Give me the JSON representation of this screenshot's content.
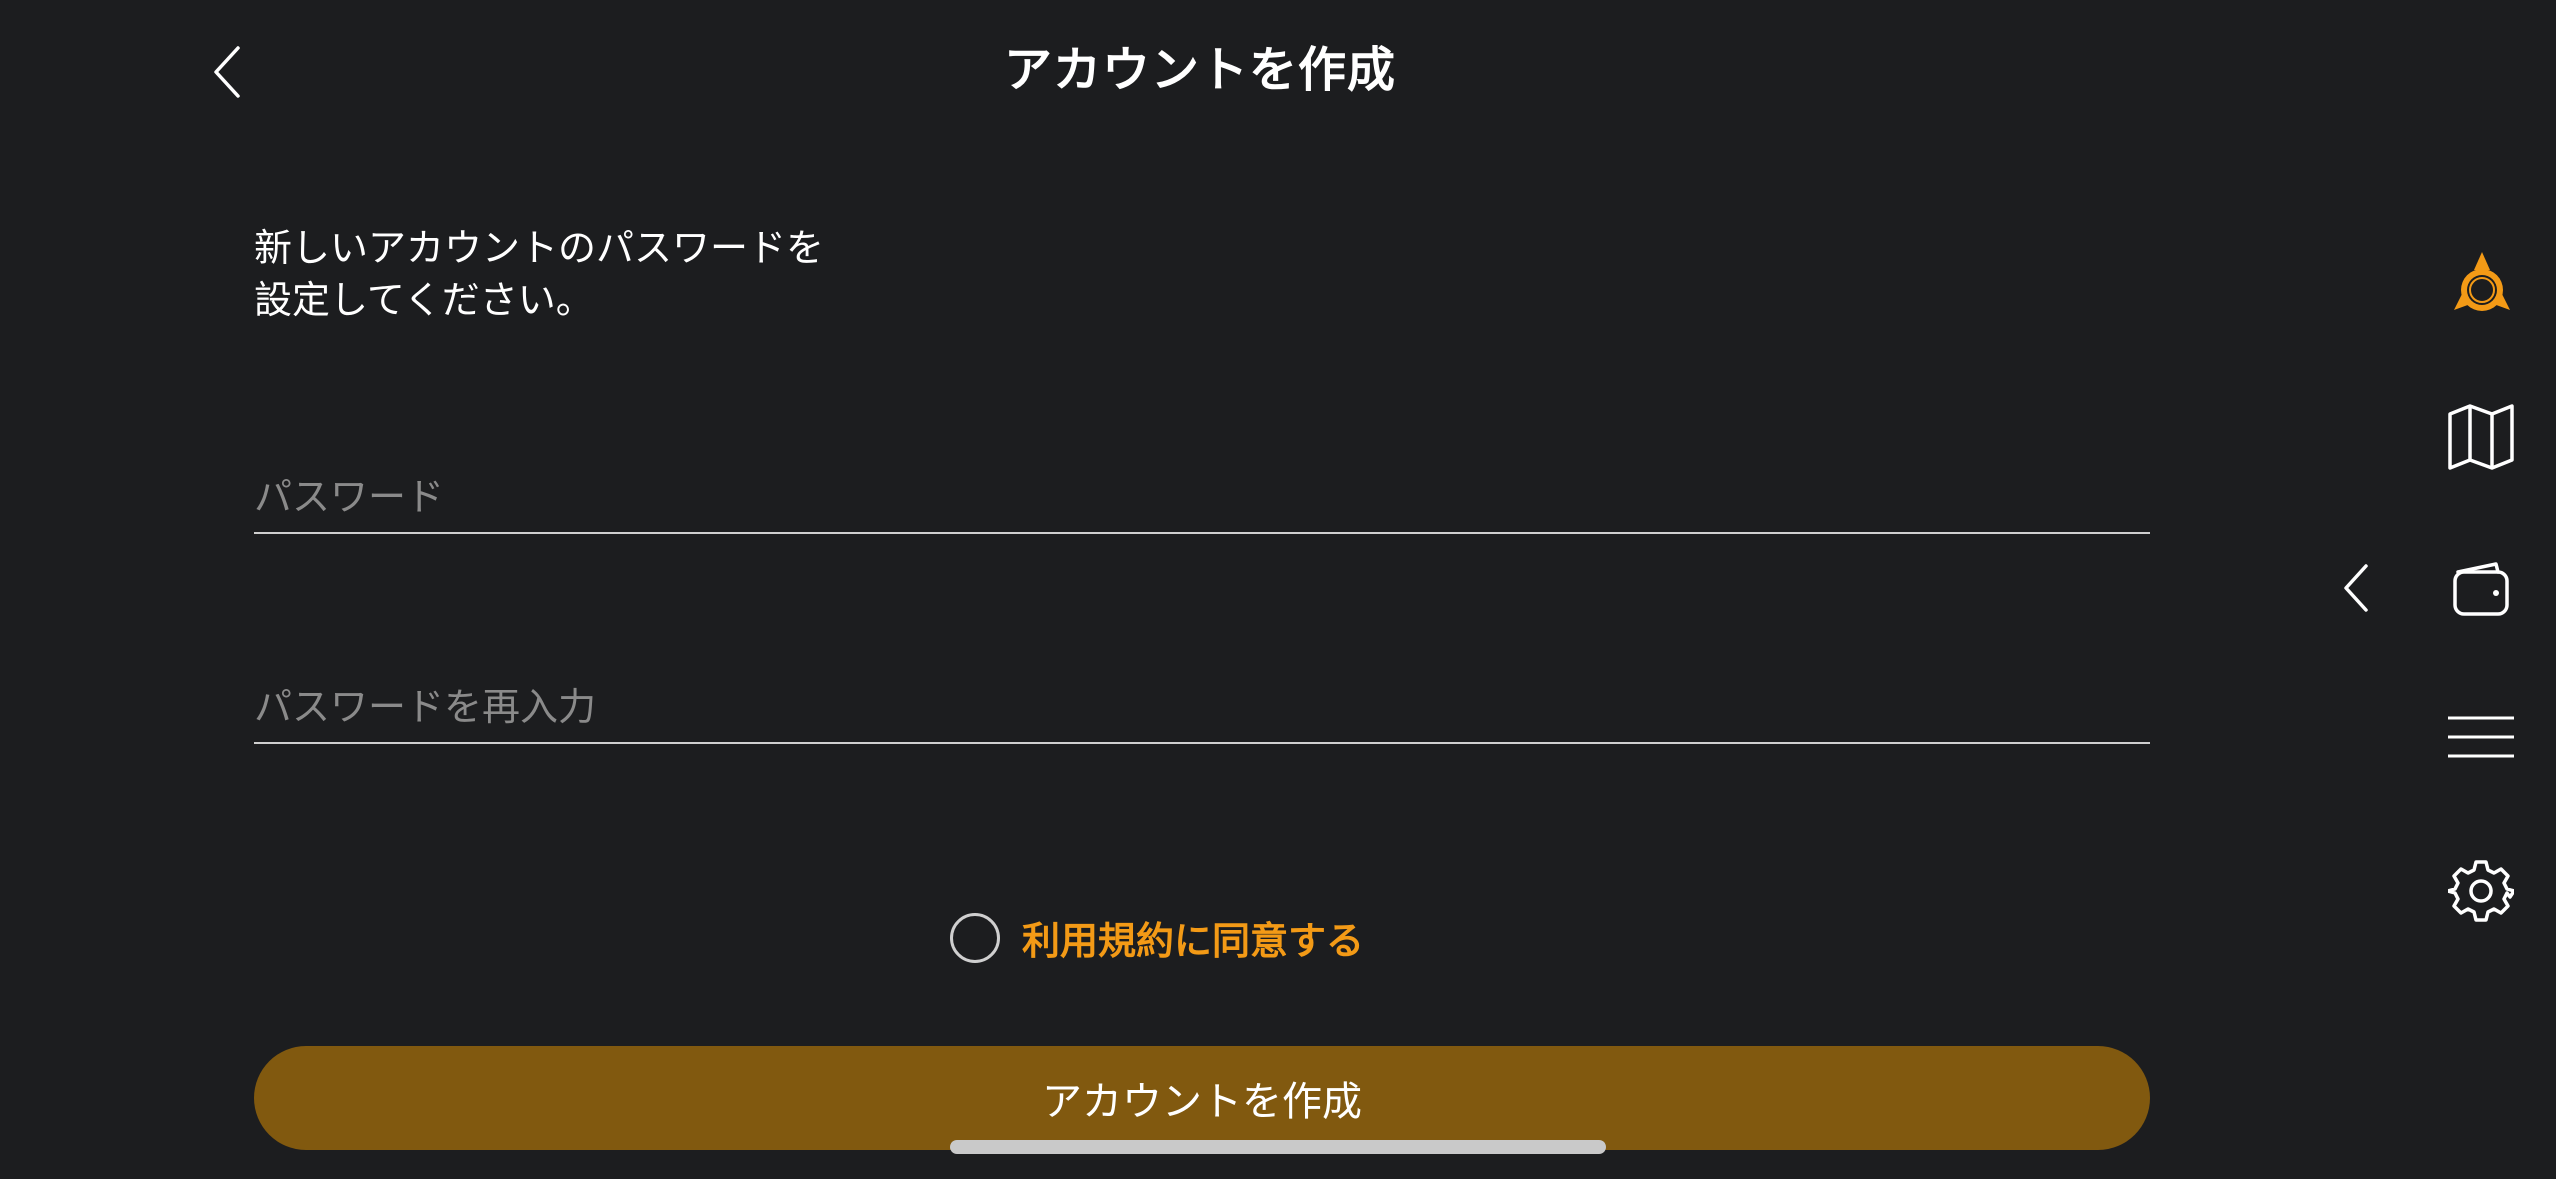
{
  "header": {
    "title": "アカウントを作成",
    "back_icon": "chevron-left-icon"
  },
  "instructions": {
    "line1": "新しいアカウントのパスワードを",
    "line2": "設定してください。"
  },
  "form": {
    "password": {
      "placeholder": "パスワード",
      "value": ""
    },
    "confirm_password": {
      "placeholder": "パスワードを再入力",
      "value": ""
    },
    "terms": {
      "label": "利用規約に同意する",
      "checked": false
    },
    "submit_label": "アカウントを作成"
  },
  "sidebar": {
    "collapse_icon": "chevron-left-icon",
    "items": [
      {
        "icon": "logo-icon"
      },
      {
        "icon": "map-icon"
      },
      {
        "icon": "wallet-icon"
      },
      {
        "icon": "menu-icon"
      },
      {
        "icon": "gear-icon"
      }
    ]
  },
  "colors": {
    "background": "#1c1d1f",
    "accent": "#f39a16",
    "button": "#81590f"
  }
}
